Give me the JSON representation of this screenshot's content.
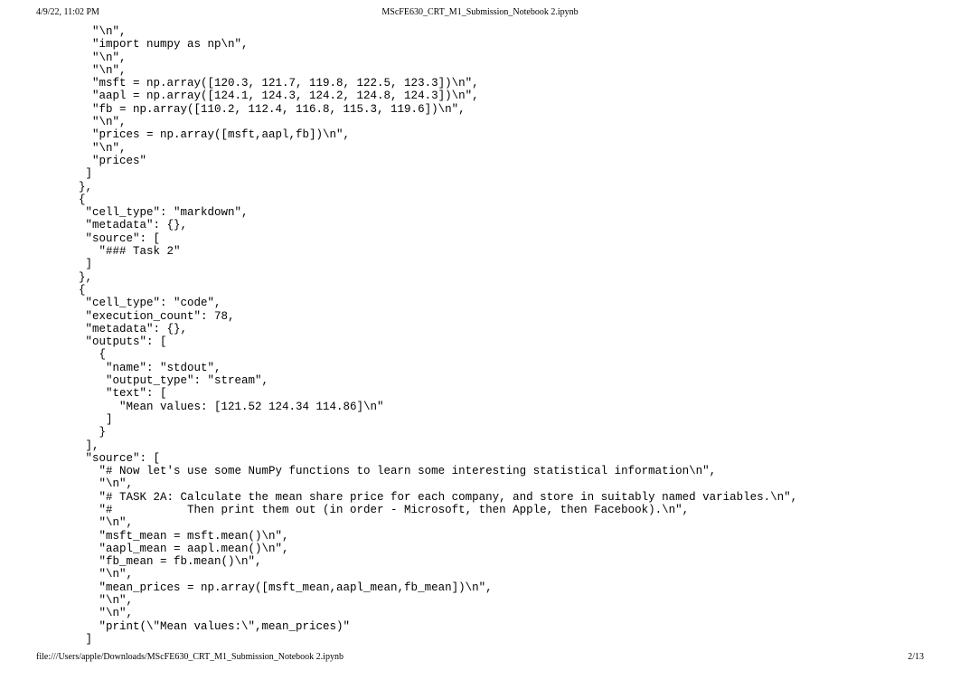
{
  "header": {
    "timestamp": "4/9/22, 11:02 PM",
    "title": "MScFE630_CRT_M1_Submission_Notebook 2.ipynb"
  },
  "lines": [
    "\"\\n\",",
    "\"import numpy as np\\n\",",
    "\"\\n\",",
    "\"\\n\",",
    "\"msft = np.array([120.3, 121.7, 119.8, 122.5, 123.3])\\n\",",
    "\"aapl = np.array([124.1, 124.3, 124.2, 124.8, 124.3])\\n\",",
    "\"fb = np.array([110.2, 112.4, 116.8, 115.3, 119.6])\\n\",",
    "\"\\n\",",
    "\"prices = np.array([msft,aapl,fb])\\n\",",
    "\"\\n\",",
    "\"prices\"",
    "]",
    "},",
    "{",
    " \"cell_type\": \"markdown\",",
    " \"metadata\": {},",
    " \"source\": [",
    "  \"### Task 2\"",
    " ]",
    "},",
    "{",
    " \"cell_type\": \"code\",",
    " \"execution_count\": 78,",
    " \"metadata\": {},",
    " \"outputs\": [",
    "  {",
    "   \"name\": \"stdout\",",
    "   \"output_type\": \"stream\",",
    "   \"text\": [",
    "    \"Mean values: [121.52 124.34 114.86]\\n\"",
    "   ]",
    "  }",
    " ],",
    " \"source\": [",
    "  \"# Now let's use some NumPy functions to learn some interesting statistical information\\n\",",
    "  \"\\n\",",
    "  \"# TASK 2A: Calculate the mean share price for each company, and store in suitably named variables.\\n\",",
    "  \"#           Then print them out (in order - Microsoft, then Apple, then Facebook).\\n\",",
    "  \"\\n\",",
    "  \"msft_mean = msft.mean()\\n\",",
    "  \"aapl_mean = aapl.mean()\\n\",",
    "  \"fb_mean = fb.mean()\\n\",",
    "  \"\\n\",",
    "  \"mean_prices = np.array([msft_mean,aapl_mean,fb_mean])\\n\",",
    "  \"\\n\",",
    "  \"\\n\",",
    "  \"print(\\\"Mean values:\\\",mean_prices)\"",
    " ]"
  ],
  "indents": [
    4,
    4,
    4,
    4,
    4,
    4,
    4,
    4,
    4,
    4,
    4,
    3,
    2,
    2,
    2,
    2,
    2,
    3,
    2,
    2,
    2,
    2,
    2,
    2,
    2,
    3,
    3,
    3,
    3,
    4,
    3,
    3,
    2,
    2,
    3,
    3,
    3,
    3,
    3,
    3,
    3,
    3,
    3,
    3,
    3,
    3,
    3,
    2
  ],
  "footer": {
    "path": "file:///Users/apple/Downloads/MScFE630_CRT_M1_Submission_Notebook 2.ipynb",
    "page": "2/13"
  }
}
